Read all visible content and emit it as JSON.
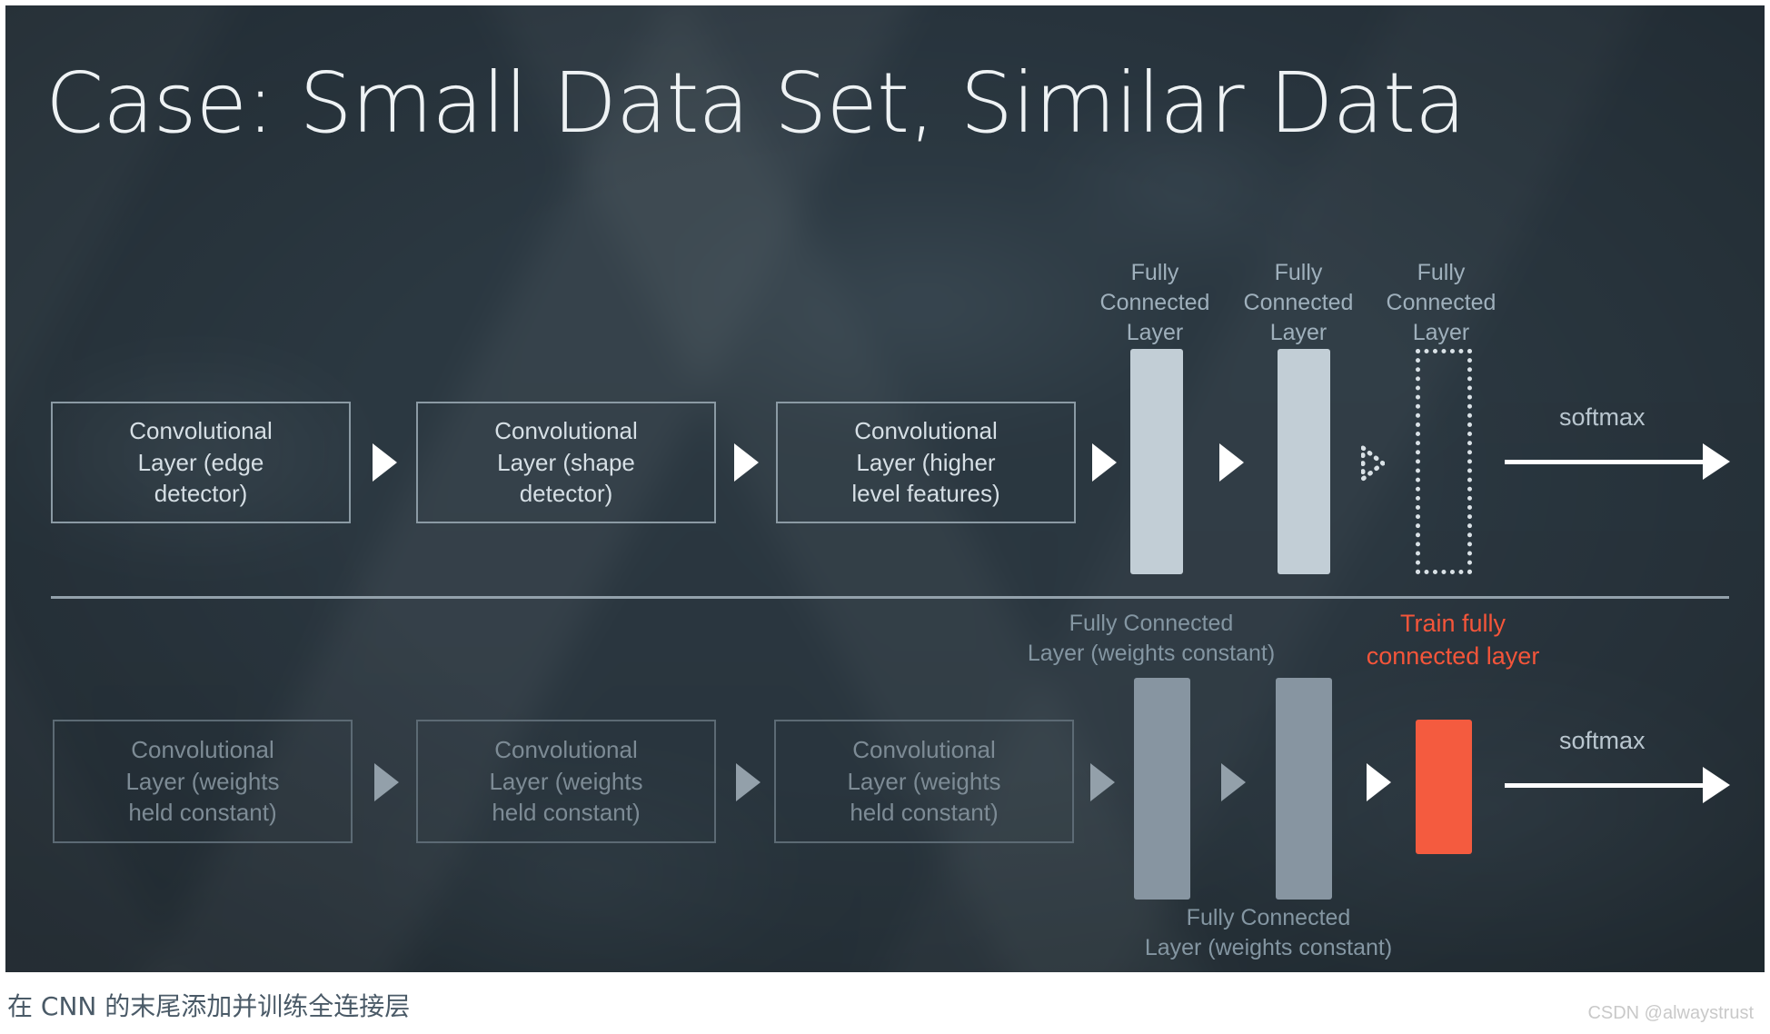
{
  "slide": {
    "title": "Case: Small Data Set, Similar Data",
    "background_color": "#2a3740"
  },
  "colors": {
    "slide_bg": "#2a3740",
    "box_border": "#8b9aa4",
    "box_border_dim": "#5c6a74",
    "text": "#d6dfe5",
    "text_dim": "#7d8b95",
    "bar_light": "#c2ced6",
    "bar_grey": "#8795a1",
    "bar_red": "#f45b3f",
    "accent_red": "#f4553a",
    "divider": "#93a1ab"
  },
  "top_row": {
    "conv_boxes": [
      {
        "text": "Convolutional\nLayer (edge\ndetector)"
      },
      {
        "text": "Convolutional\nLayer (shape\ndetector)"
      },
      {
        "text": "Convolutional\nLayer (higher\nlevel features)"
      }
    ],
    "fc_labels": [
      "Fully\nConnected\nLayer",
      "Fully\nConnected\nLayer",
      "Fully\nConnected\nLayer"
    ],
    "softmax_label": "softmax",
    "arrow_icons": [
      "play-arrow",
      "play-arrow",
      "play-arrow",
      "play-arrow",
      "dotted-play-arrow"
    ]
  },
  "bottom_row": {
    "conv_boxes": [
      {
        "text": "Convolutional\nLayer (weights\nheld constant)"
      },
      {
        "text": "Convolutional\nLayer (weights\nheld constant)"
      },
      {
        "text": "Convolutional\nLayer (weights\nheld constant)"
      }
    ],
    "fc_label_top": "Fully Connected\nLayer (weights constant)",
    "fc_label_bottom": "Fully Connected\nLayer (weights constant)",
    "train_label": "Train fully\nconnected layer",
    "softmax_label": "softmax",
    "arrow_icons": [
      "play-arrow",
      "play-arrow",
      "play-arrow",
      "play-arrow",
      "play-arrow"
    ]
  },
  "caption": "在 CNN 的末尾添加并训练全连接层",
  "watermark": "CSDN @alwaystrust"
}
